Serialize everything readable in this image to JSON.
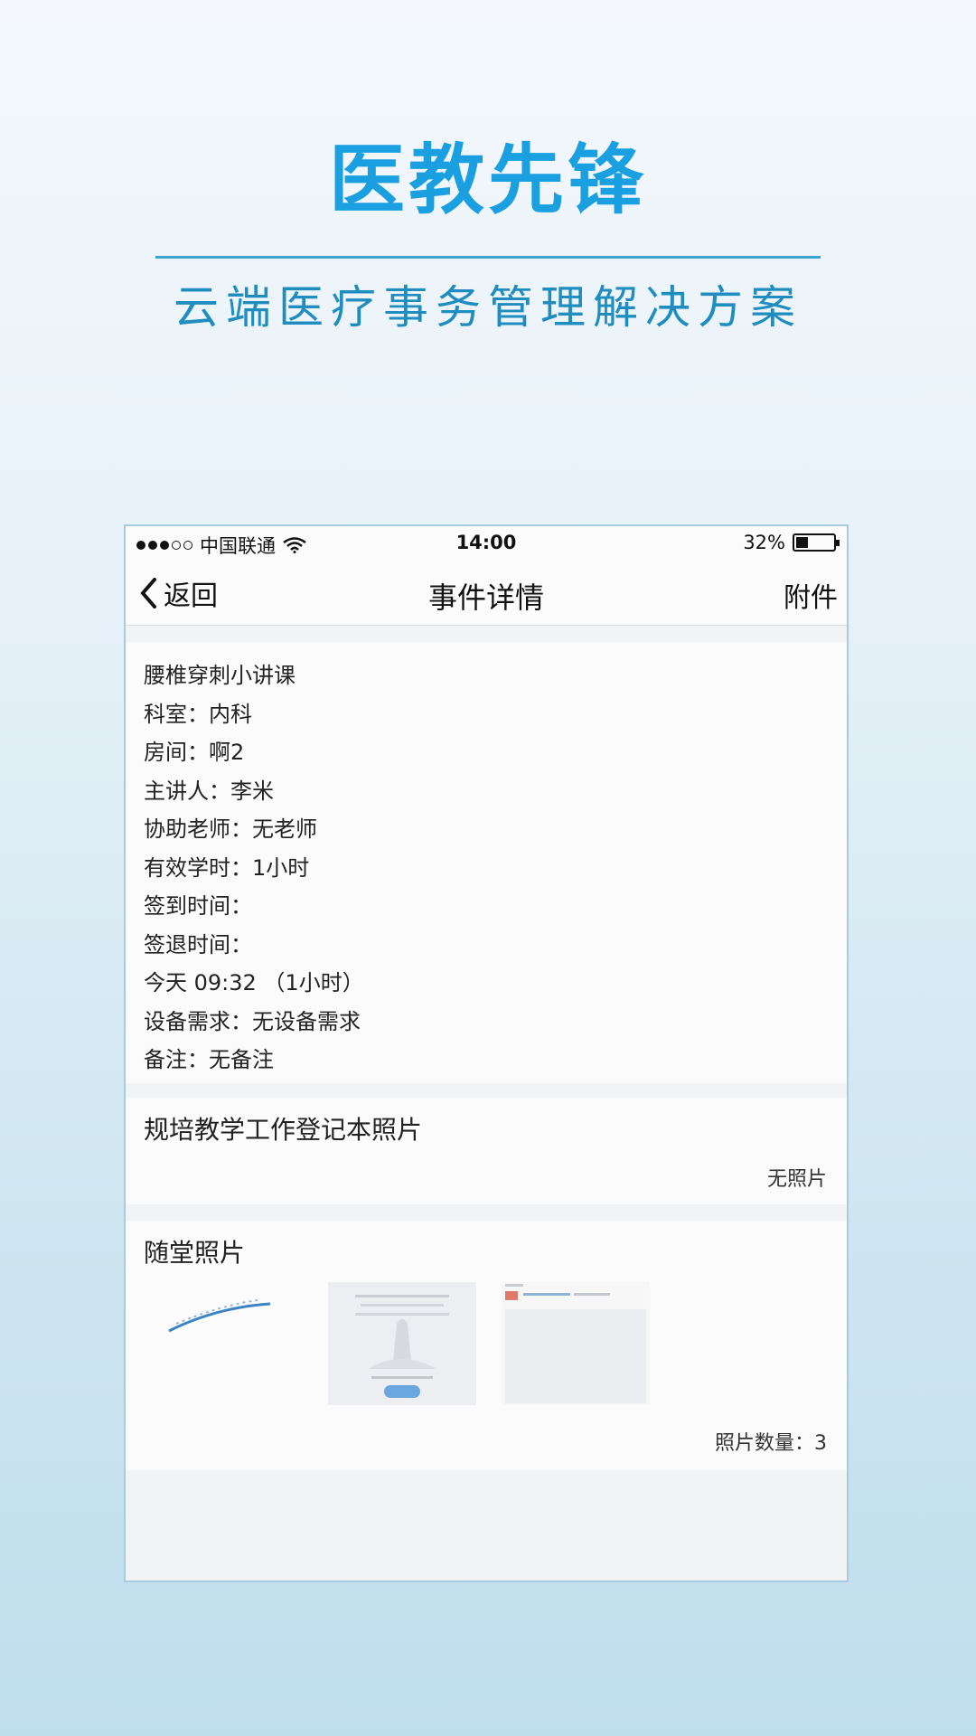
{
  "hero": {
    "title": "医教先锋",
    "subtitle": "云端医疗事务管理解决方案"
  },
  "status_bar": {
    "carrier": "中国联通",
    "time": "14:00",
    "battery": "32%",
    "battery_level": 0.32,
    "wifi_icon": "wifi-icon",
    "battery_icon": "battery-icon"
  },
  "nav": {
    "back_label": "返回",
    "title": "事件详情",
    "attach_label": "附件",
    "back_icon": "chevron-left-icon"
  },
  "event": {
    "lines": [
      "腰椎穿刺小讲课",
      "科室：内科",
      "房间：啊2",
      "主讲人：李米",
      "协助老师：无老师",
      "有效学时：1小时",
      "签到时间：",
      "签退时间：",
      "今天 09:32 （1小时）",
      "设备需求：无设备需求",
      "备注：无备注"
    ]
  },
  "registration_photos": {
    "label": "规培教学工作登记本照片",
    "empty_text": "无照片"
  },
  "class_photos": {
    "label": "随堂照片",
    "count_text": "照片数量：3",
    "count": 3
  },
  "colors": {
    "accent": "#1aa0e0",
    "subtitle": "#1f8dbf",
    "frame": "#a9cbe0",
    "panel_bg": "#fbfbfb",
    "gap_bg": "#f1f3f5"
  }
}
